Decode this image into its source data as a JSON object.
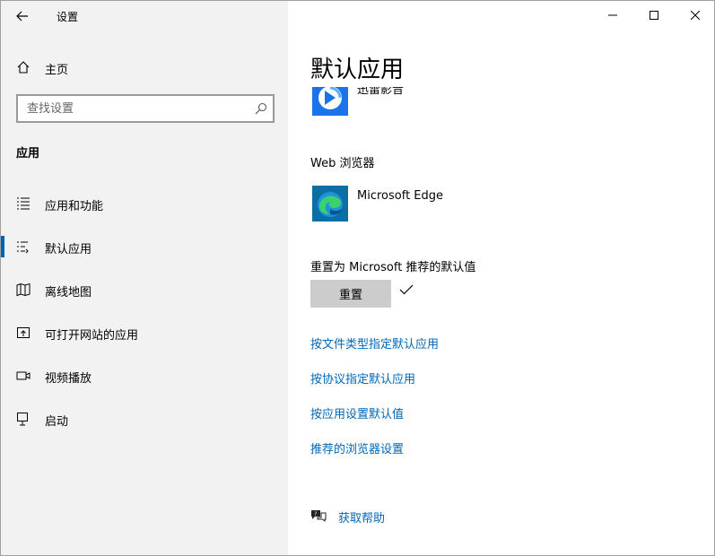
{
  "window": {
    "title": "设置",
    "minimize_icon": "minimize-icon",
    "maximize_icon": "maximize-icon",
    "close_icon": "close-icon"
  },
  "sidebar": {
    "home_label": "主页",
    "search_placeholder": "查找设置",
    "section_title": "应用",
    "items": [
      {
        "label": "应用和功能",
        "icon": "list-icon",
        "selected": false
      },
      {
        "label": "默认应用",
        "icon": "default-apps-icon",
        "selected": true
      },
      {
        "label": "离线地图",
        "icon": "map-icon",
        "selected": false
      },
      {
        "label": "可打开网站的应用",
        "icon": "open-site-icon",
        "selected": false
      },
      {
        "label": "视频播放",
        "icon": "video-icon",
        "selected": false
      },
      {
        "label": "启动",
        "icon": "startup-icon",
        "selected": false
      }
    ]
  },
  "main": {
    "page_title": "默认应用",
    "video_player": {
      "app_name": "迅雷影音"
    },
    "web_browser": {
      "label": "Web 浏览器",
      "app_name": "Microsoft Edge"
    },
    "reset": {
      "label": "重置为 Microsoft 推荐的默认值",
      "button": "重置"
    },
    "links": [
      "按文件类型指定默认应用",
      "按协议指定默认应用",
      "按应用设置默认值",
      "推荐的浏览器设置"
    ],
    "help_label": "获取帮助"
  },
  "colors": {
    "accent": "#0063b1",
    "link": "#0067b8",
    "sidebar_bg": "#f2f2f2",
    "button_bg": "#cccccc"
  }
}
